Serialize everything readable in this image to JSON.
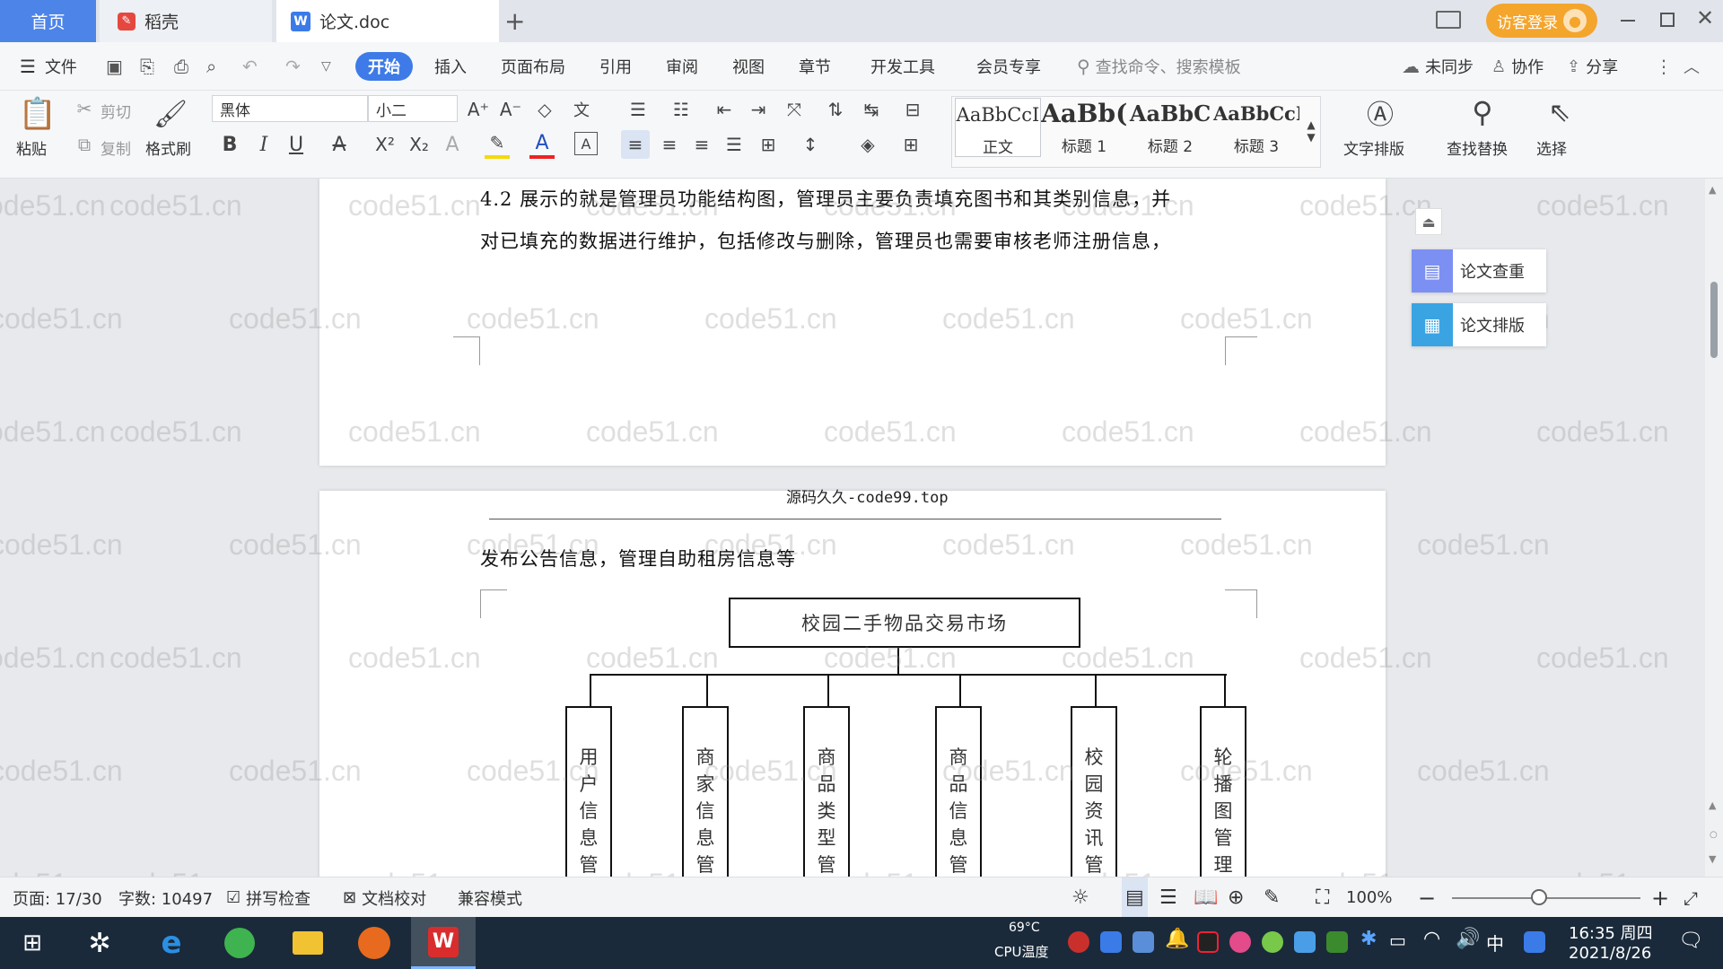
{
  "tabs": {
    "home": "首页",
    "daoke": "稻壳",
    "doc": "论文.doc",
    "add": "+"
  },
  "window": {
    "visitor_login": "访客登录"
  },
  "menu": {
    "file": "文件",
    "items": [
      "开始",
      "插入",
      "页面布局",
      "引用",
      "审阅",
      "视图",
      "章节",
      "开发工具",
      "会员专享"
    ],
    "search_placeholder": "查找命令、搜索模板",
    "sync": "未同步",
    "collab": "协作",
    "share": "分享"
  },
  "ribbon": {
    "paste": "粘贴",
    "cut": "剪切",
    "copy": "复制",
    "format_painter": "格式刷",
    "font_name": "黑体",
    "font_size": "小二",
    "styles": [
      {
        "preview": "AaBbCcI",
        "label": "正文"
      },
      {
        "preview": "AaBb(",
        "label": "标题 1"
      },
      {
        "preview": "AaBbC",
        "label": "标题 2"
      },
      {
        "preview": "AaBbCcI",
        "label": "标题 3"
      }
    ],
    "text_layout": "文字排版",
    "find_replace": "查找替换",
    "select": "选择"
  },
  "side_panel": {
    "check": "论文查重",
    "layout": "论文排版"
  },
  "document": {
    "line1": "4.2 展示的就是管理员功能结构图，管理员主要负责填充图书和其类别信息，并",
    "line2": "对已填充的数据进行维护，包括修改与删除，管理员也需要审核老师注册信息，",
    "header": "源码久久-code99.top",
    "line3": "发布公告信息，管理自助租房信息等",
    "diagram_root": "校园二手物品交易市场",
    "diagram_children": [
      "用户信息管",
      "商家信息管",
      "商品类型管",
      "商品信息管",
      "校园资讯管",
      "轮播图管理"
    ]
  },
  "watermark": "code51.cn",
  "status": {
    "page": "页面: 17/30",
    "words": "字数: 10497",
    "spell": "拼写检查",
    "proof": "文档校对",
    "compat": "兼容模式",
    "zoom": "100%"
  },
  "taskbar": {
    "cpu_temp": "69°C",
    "cpu_label": "CPU温度",
    "time": "16:35 周四",
    "date": "2021/8/26",
    "ime": "中"
  }
}
